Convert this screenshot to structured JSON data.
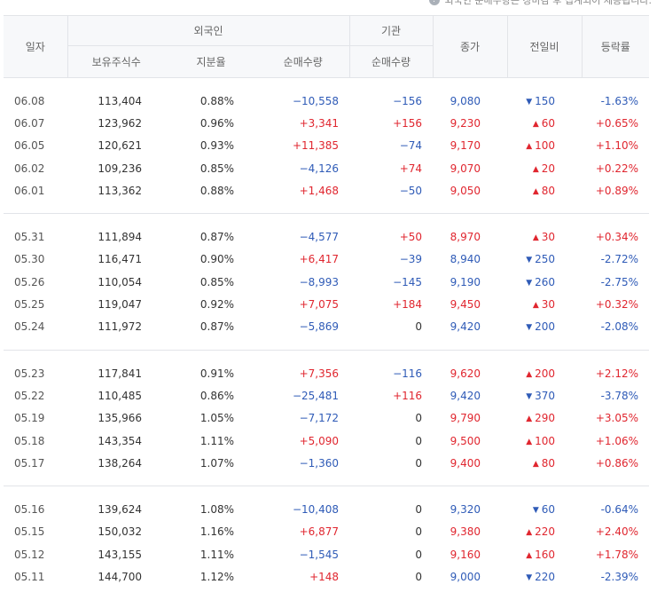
{
  "note": "외국인 순매수량은 장마감 후 집계되어 제공됩니다.",
  "headers": {
    "date": "일자",
    "foreign_group": "외국인",
    "institution_group": "기관",
    "close": "종가",
    "change": "전일비",
    "rate": "등락률",
    "holdings": "보유주식수",
    "ratio": "지분율",
    "foreign_net": "순매수량",
    "institution_net": "순매수량"
  },
  "colors": {
    "up": "#e0262f",
    "down": "#2f5bb7"
  },
  "groups": [
    {
      "rows": [
        {
          "date": "06.08",
          "holdings": "113,404",
          "ratio": "0.88%",
          "foreign_net": "−10,558",
          "fdir": "down",
          "inst_net": "−156",
          "idir": "down",
          "close": "9,080",
          "cdir": "down",
          "change": "150",
          "chdir": "down",
          "rate": "-1.63%",
          "rdir": "down"
        },
        {
          "date": "06.07",
          "holdings": "123,962",
          "ratio": "0.96%",
          "foreign_net": "+3,341",
          "fdir": "up",
          "inst_net": "+156",
          "idir": "up",
          "close": "9,230",
          "cdir": "up",
          "change": "60",
          "chdir": "up",
          "rate": "+0.65%",
          "rdir": "up"
        },
        {
          "date": "06.05",
          "holdings": "120,621",
          "ratio": "0.93%",
          "foreign_net": "+11,385",
          "fdir": "up",
          "inst_net": "−74",
          "idir": "down",
          "close": "9,170",
          "cdir": "up",
          "change": "100",
          "chdir": "up",
          "rate": "+1.10%",
          "rdir": "up"
        },
        {
          "date": "06.02",
          "holdings": "109,236",
          "ratio": "0.85%",
          "foreign_net": "−4,126",
          "fdir": "down",
          "inst_net": "+74",
          "idir": "up",
          "close": "9,070",
          "cdir": "up",
          "change": "20",
          "chdir": "up",
          "rate": "+0.22%",
          "rdir": "up"
        },
        {
          "date": "06.01",
          "holdings": "113,362",
          "ratio": "0.88%",
          "foreign_net": "+1,468",
          "fdir": "up",
          "inst_net": "−50",
          "idir": "down",
          "close": "9,050",
          "cdir": "up",
          "change": "80",
          "chdir": "up",
          "rate": "+0.89%",
          "rdir": "up"
        }
      ]
    },
    {
      "rows": [
        {
          "date": "05.31",
          "holdings": "111,894",
          "ratio": "0.87%",
          "foreign_net": "−4,577",
          "fdir": "down",
          "inst_net": "+50",
          "idir": "up",
          "close": "8,970",
          "cdir": "up",
          "change": "30",
          "chdir": "up",
          "rate": "+0.34%",
          "rdir": "up"
        },
        {
          "date": "05.30",
          "holdings": "116,471",
          "ratio": "0.90%",
          "foreign_net": "+6,417",
          "fdir": "up",
          "inst_net": "−39",
          "idir": "down",
          "close": "8,940",
          "cdir": "down",
          "change": "250",
          "chdir": "down",
          "rate": "-2.72%",
          "rdir": "down"
        },
        {
          "date": "05.26",
          "holdings": "110,054",
          "ratio": "0.85%",
          "foreign_net": "−8,993",
          "fdir": "down",
          "inst_net": "−145",
          "idir": "down",
          "close": "9,190",
          "cdir": "down",
          "change": "260",
          "chdir": "down",
          "rate": "-2.75%",
          "rdir": "down"
        },
        {
          "date": "05.25",
          "holdings": "119,047",
          "ratio": "0.92%",
          "foreign_net": "+7,075",
          "fdir": "up",
          "inst_net": "+184",
          "idir": "up",
          "close": "9,450",
          "cdir": "up",
          "change": "30",
          "chdir": "up",
          "rate": "+0.32%",
          "rdir": "up"
        },
        {
          "date": "05.24",
          "holdings": "111,972",
          "ratio": "0.87%",
          "foreign_net": "−5,869",
          "fdir": "down",
          "inst_net": "0",
          "idir": "flat",
          "close": "9,420",
          "cdir": "down",
          "change": "200",
          "chdir": "down",
          "rate": "-2.08%",
          "rdir": "down"
        }
      ]
    },
    {
      "rows": [
        {
          "date": "05.23",
          "holdings": "117,841",
          "ratio": "0.91%",
          "foreign_net": "+7,356",
          "fdir": "up",
          "inst_net": "−116",
          "idir": "down",
          "close": "9,620",
          "cdir": "up",
          "change": "200",
          "chdir": "up",
          "rate": "+2.12%",
          "rdir": "up"
        },
        {
          "date": "05.22",
          "holdings": "110,485",
          "ratio": "0.86%",
          "foreign_net": "−25,481",
          "fdir": "down",
          "inst_net": "+116",
          "idir": "up",
          "close": "9,420",
          "cdir": "down",
          "change": "370",
          "chdir": "down",
          "rate": "-3.78%",
          "rdir": "down"
        },
        {
          "date": "05.19",
          "holdings": "135,966",
          "ratio": "1.05%",
          "foreign_net": "−7,172",
          "fdir": "down",
          "inst_net": "0",
          "idir": "flat",
          "close": "9,790",
          "cdir": "up",
          "change": "290",
          "chdir": "up",
          "rate": "+3.05%",
          "rdir": "up"
        },
        {
          "date": "05.18",
          "holdings": "143,354",
          "ratio": "1.11%",
          "foreign_net": "+5,090",
          "fdir": "up",
          "inst_net": "0",
          "idir": "flat",
          "close": "9,500",
          "cdir": "up",
          "change": "100",
          "chdir": "up",
          "rate": "+1.06%",
          "rdir": "up"
        },
        {
          "date": "05.17",
          "holdings": "138,264",
          "ratio": "1.07%",
          "foreign_net": "−1,360",
          "fdir": "down",
          "inst_net": "0",
          "idir": "flat",
          "close": "9,400",
          "cdir": "up",
          "change": "80",
          "chdir": "up",
          "rate": "+0.86%",
          "rdir": "up"
        }
      ]
    },
    {
      "rows": [
        {
          "date": "05.16",
          "holdings": "139,624",
          "ratio": "1.08%",
          "foreign_net": "−10,408",
          "fdir": "down",
          "inst_net": "0",
          "idir": "flat",
          "close": "9,320",
          "cdir": "down",
          "change": "60",
          "chdir": "down",
          "rate": "-0.64%",
          "rdir": "down"
        },
        {
          "date": "05.15",
          "holdings": "150,032",
          "ratio": "1.16%",
          "foreign_net": "+6,877",
          "fdir": "up",
          "inst_net": "0",
          "idir": "flat",
          "close": "9,380",
          "cdir": "up",
          "change": "220",
          "chdir": "up",
          "rate": "+2.40%",
          "rdir": "up"
        },
        {
          "date": "05.12",
          "holdings": "143,155",
          "ratio": "1.11%",
          "foreign_net": "−1,545",
          "fdir": "down",
          "inst_net": "0",
          "idir": "flat",
          "close": "9,160",
          "cdir": "up",
          "change": "160",
          "chdir": "up",
          "rate": "+1.78%",
          "rdir": "up"
        },
        {
          "date": "05.11",
          "holdings": "144,700",
          "ratio": "1.12%",
          "foreign_net": "+148",
          "fdir": "up",
          "inst_net": "0",
          "idir": "flat",
          "close": "9,000",
          "cdir": "down",
          "change": "220",
          "chdir": "down",
          "rate": "-2.39%",
          "rdir": "down"
        }
      ]
    }
  ]
}
